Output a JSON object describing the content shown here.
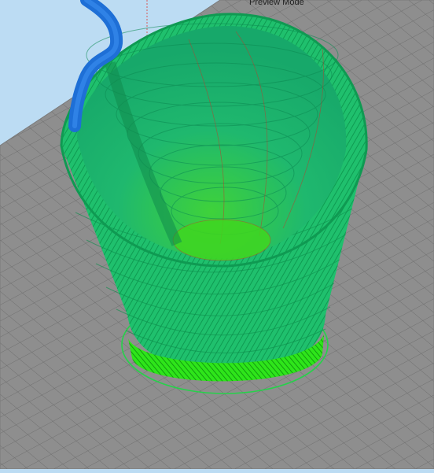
{
  "viewport": {
    "mode_label": "Preview Mode",
    "colors": {
      "background": "#bcdcf3",
      "build_plate": "#8e8e8e",
      "grid_line": "#6f6f6f",
      "toolpath_green": "#1fbf6f",
      "toolpath_bright": "#22dd11",
      "toolpath_blue": "#1e6fd6",
      "toolpath_red": "#c0392b"
    },
    "icons": {
      "printed_object": "cup-toolpath-preview",
      "build_plate": "grid-plate"
    }
  }
}
